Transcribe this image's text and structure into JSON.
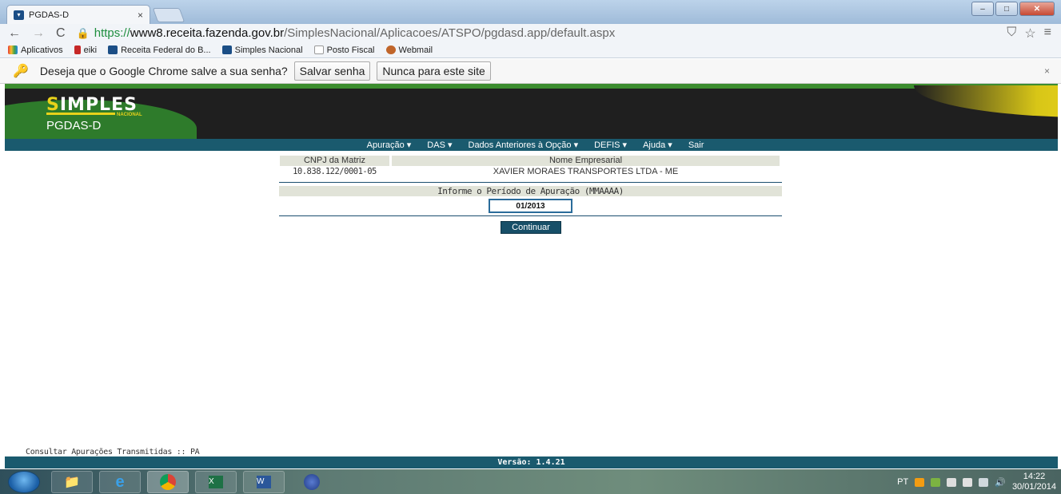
{
  "browser": {
    "tab_title": "PGDAS-D",
    "tab_close": "×",
    "url_scheme": "https://",
    "url_host": "www8.receita.fazenda.gov.br",
    "url_path": "/SimplesNacional/Aplicacoes/ATSPO/pgdasd.app/default.aspx",
    "bookmarks": [
      "Aplicativos",
      "eiki",
      "Receita Federal do B...",
      "Simples Nacional",
      "Posto Fiscal",
      "Webmail"
    ],
    "infobar_text": "Deseja que o Google Chrome salve a sua senha?",
    "save_password_label": "Salvar senha",
    "never_label": "Nunca para este site",
    "infobar_close": "×"
  },
  "header": {
    "logo_text": "IMPLES",
    "logo_sub": "NACIONAL",
    "app_name": "PGDAS-D"
  },
  "menu": [
    "Apuração ▾",
    "DAS ▾",
    "Dados Anteriores à Opção ▾",
    "DEFIS ▾",
    "Ajuda ▾",
    "Sair"
  ],
  "company": {
    "cnpj_header": "CNPJ da Matriz",
    "name_header": "Nome Empresarial",
    "cnpj": "10.838.122/0001-05",
    "name": "XAVIER MORAES TRANSPORTES LTDA - ME"
  },
  "period": {
    "label": "Informe o Período de Apuração (MMAAAA)",
    "value": "01/2013"
  },
  "continue_label": "Continuar",
  "footer": {
    "link_text": "Consultar Apurações Transmitidas :: PA",
    "version": "Versão: 1.4.21"
  },
  "taskbar": {
    "language": "PT",
    "time": "14:22",
    "date": "30/01/2014"
  },
  "colors": {
    "accent": "#1a5a6e",
    "header_bg": "#1f1f1f",
    "brand_yellow": "#e8d21a",
    "brand_green": "#2e7b2b",
    "label_bg": "#e1e3d8"
  }
}
